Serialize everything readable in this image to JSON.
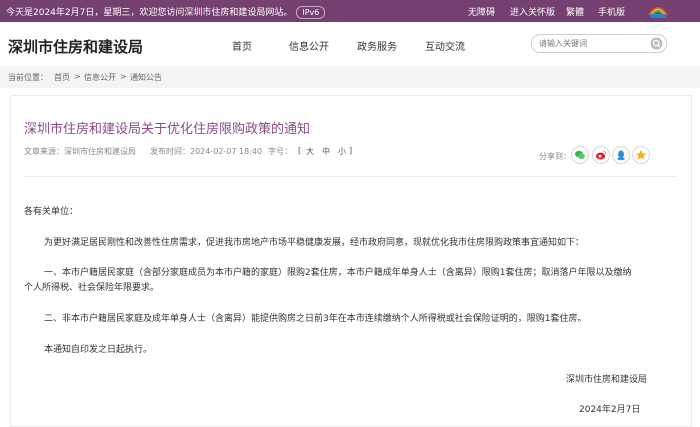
{
  "topbar": {
    "welcome": "今天是2024年2月7日，星期三，欢迎您访问深圳市住房和建设局网站。",
    "ipv6": "IPv6",
    "links": [
      "无障碍",
      "进入关怀版",
      "繁體",
      "手机版"
    ]
  },
  "header": {
    "site_title": "深圳市住房和建设局",
    "nav": [
      "首页",
      "信息公开",
      "政务服务",
      "互动交流"
    ],
    "search_placeholder": "请输入关键词"
  },
  "breadcrumb": {
    "label": "当前位置：",
    "items": [
      "首页",
      "信息公开",
      "通知公告"
    ],
    "separator": ">"
  },
  "article": {
    "title": "深圳市住房和建设局关于优化住房限购政策的通知",
    "source": "文章来源：深圳市住房和建设局",
    "publish_time": "发布时间：2024-02-07 18:40",
    "font_size_label": "字号：",
    "font_sizes": [
      "[",
      "大",
      "中",
      "小",
      "]"
    ],
    "share_label": "分享到：",
    "share_icons": [
      "wechat-icon",
      "weibo-icon",
      "qq-icon",
      "qzone-icon"
    ],
    "paragraphs": [
      "各有关单位：",
      "为更好满足居民刚性和改善性住房需求，促进我市房地产市场平稳健康发展，经市政府同意，现就优化我市住房限购政策事宜通知如下：",
      "一、本市户籍居民家庭（含部分家庭成员为本市户籍的家庭）限购2套住房，本市户籍成年单身人士（含离异）限购1套住房；取消落户年限以及缴纳",
      "个人所得税、社会保险年限要求。",
      "二、非本市户籍居民家庭及成年单身人士（含离异）能提供购房之日前3年在本市连续缴纳个人所得税或社会保险证明的，限购1套住房。",
      "本通知自印发之日起执行。"
    ],
    "signature": "深圳市住房和建设局",
    "date": "2024年2月7日"
  },
  "colors": {
    "topbar": "#74406f",
    "title": "#8a4b86",
    "wechat": "#3fb34f",
    "weibo": "#e6162d",
    "qq": "#2a8fdd",
    "qzone": "#f6b21c"
  }
}
